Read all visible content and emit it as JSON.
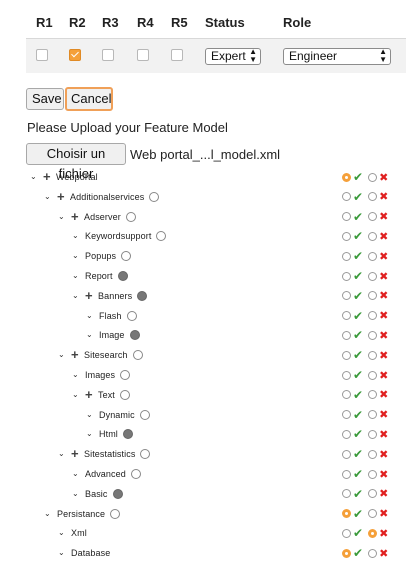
{
  "table": {
    "headers": [
      "R1",
      "R2",
      "R3",
      "R4",
      "R5",
      "Status",
      "Role"
    ],
    "row": {
      "checks": [
        false,
        true,
        false,
        false,
        false
      ],
      "status_value": "Expert",
      "role_value": "Engineer"
    }
  },
  "buttons": {
    "save_label": "Save",
    "cancel_label": "Cancel"
  },
  "upload": {
    "label": "Please Upload your Feature Model",
    "file_button": "Choisir un fichier",
    "file_name": "Web portal_...l_model.xml"
  },
  "tree": [
    {
      "label": "Webportal",
      "level": 0,
      "plus": true,
      "circle": "none",
      "yes": true,
      "no": false
    },
    {
      "label": "Additionalservices",
      "level": 1,
      "plus": true,
      "circle": "empty",
      "yes": false,
      "no": false
    },
    {
      "label": "Adserver",
      "level": 2,
      "plus": true,
      "circle": "empty",
      "yes": false,
      "no": false
    },
    {
      "label": "Keywordsupport",
      "level": 3,
      "plus": false,
      "circle": "empty",
      "yes": false,
      "no": false
    },
    {
      "label": "Popups",
      "level": 3,
      "plus": false,
      "circle": "empty",
      "yes": false,
      "no": false
    },
    {
      "label": "Report",
      "level": 3,
      "plus": false,
      "circle": "filled",
      "yes": false,
      "no": false
    },
    {
      "label": "Banners",
      "level": 3,
      "plus": true,
      "circle": "filled",
      "yes": false,
      "no": false
    },
    {
      "label": "Flash",
      "level": 4,
      "plus": false,
      "circle": "empty",
      "yes": false,
      "no": false
    },
    {
      "label": "Image",
      "level": 4,
      "plus": false,
      "circle": "filled",
      "yes": false,
      "no": false
    },
    {
      "label": "Sitesearch",
      "level": 2,
      "plus": true,
      "circle": "empty",
      "yes": false,
      "no": false
    },
    {
      "label": "Images",
      "level": 3,
      "plus": false,
      "circle": "empty",
      "yes": false,
      "no": false
    },
    {
      "label": "Text",
      "level": 3,
      "plus": true,
      "circle": "empty",
      "yes": false,
      "no": false
    },
    {
      "label": "Dynamic",
      "level": 4,
      "plus": false,
      "circle": "empty",
      "yes": false,
      "no": false
    },
    {
      "label": "Html",
      "level": 4,
      "plus": false,
      "circle": "filled",
      "yes": false,
      "no": false
    },
    {
      "label": "Sitestatistics",
      "level": 2,
      "plus": true,
      "circle": "empty",
      "yes": false,
      "no": false
    },
    {
      "label": "Advanced",
      "level": 3,
      "plus": false,
      "circle": "empty",
      "yes": false,
      "no": false
    },
    {
      "label": "Basic",
      "level": 3,
      "plus": false,
      "circle": "filled",
      "yes": false,
      "no": false
    },
    {
      "label": "Persistance",
      "level": 1,
      "plus": false,
      "circle": "empty",
      "yes": true,
      "no": false
    },
    {
      "label": "Xml",
      "level": 2,
      "plus": false,
      "circle": "none",
      "yes": false,
      "no": true
    },
    {
      "label": "Database",
      "level": 2,
      "plus": false,
      "circle": "none",
      "yes": true,
      "no": false
    }
  ],
  "icons": {
    "chevron": "chevron-down-icon",
    "plus": "plus-icon",
    "check": "check-icon",
    "cross": "cross-icon"
  },
  "colors": {
    "selected": "#f5a03a",
    "check": "#3a9a3a",
    "cross": "#e02020"
  }
}
